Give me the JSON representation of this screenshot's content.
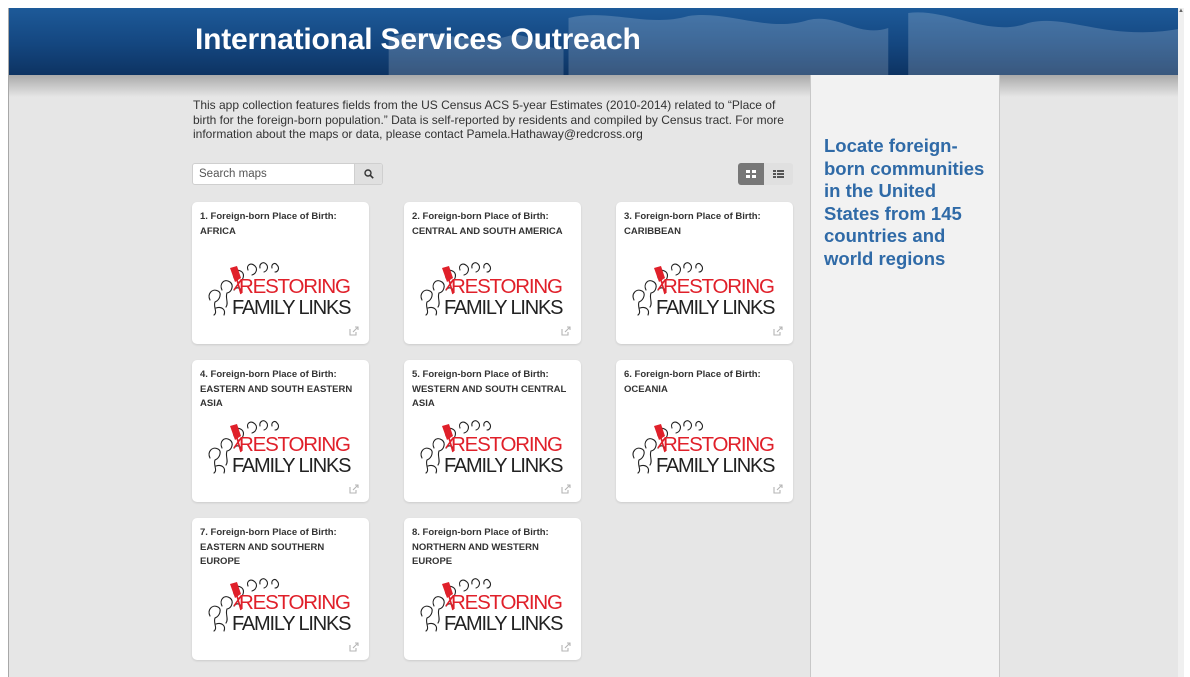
{
  "header": {
    "title": "International Services Outreach"
  },
  "description": "This app collection features fields from the US Census ACS 5-year Estimates (2010-2014) related to “Place of birth for the foreign-born population.” Data is self-reported by residents and compiled by Census tract. For more information about the maps or data, please contact Pamela.Hathaway@redcross.org",
  "search": {
    "placeholder": "Search maps",
    "value": ""
  },
  "logo": {
    "line1": "RESTORING",
    "line2": "FAMILY LINKS"
  },
  "cards": [
    {
      "title": "1. Foreign-born Place of Birth: AFRICA"
    },
    {
      "title": "2. Foreign-born Place of Birth: CENTRAL AND SOUTH AMERICA"
    },
    {
      "title": "3. Foreign-born Place of Birth: CARIBBEAN"
    },
    {
      "title": "4. Foreign-born Place of Birth: EASTERN AND SOUTH EASTERN ASIA"
    },
    {
      "title": "5. Foreign-born Place of Birth: WESTERN AND SOUTH CENTRAL ASIA"
    },
    {
      "title": "6. Foreign-born Place of Birth: OCEANIA"
    },
    {
      "title": "7. Foreign-born Place of Birth: EASTERN AND SOUTHERN EUROPE"
    },
    {
      "title": "8. Foreign-born Place of Birth: NORTHERN AND WESTERN EUROPE"
    }
  ],
  "sidebar": {
    "text": "Locate foreign-born communities in the United States from 145 countries and world regions"
  },
  "colors": {
    "header": "#14467f",
    "sidebar_text": "#2f6aa7",
    "logo_red": "#e0202a",
    "logo_dark": "#222222"
  },
  "icons": {
    "search": "search-icon",
    "grid": "grid-view-icon",
    "list": "list-view-icon",
    "external": "external-link-icon"
  }
}
